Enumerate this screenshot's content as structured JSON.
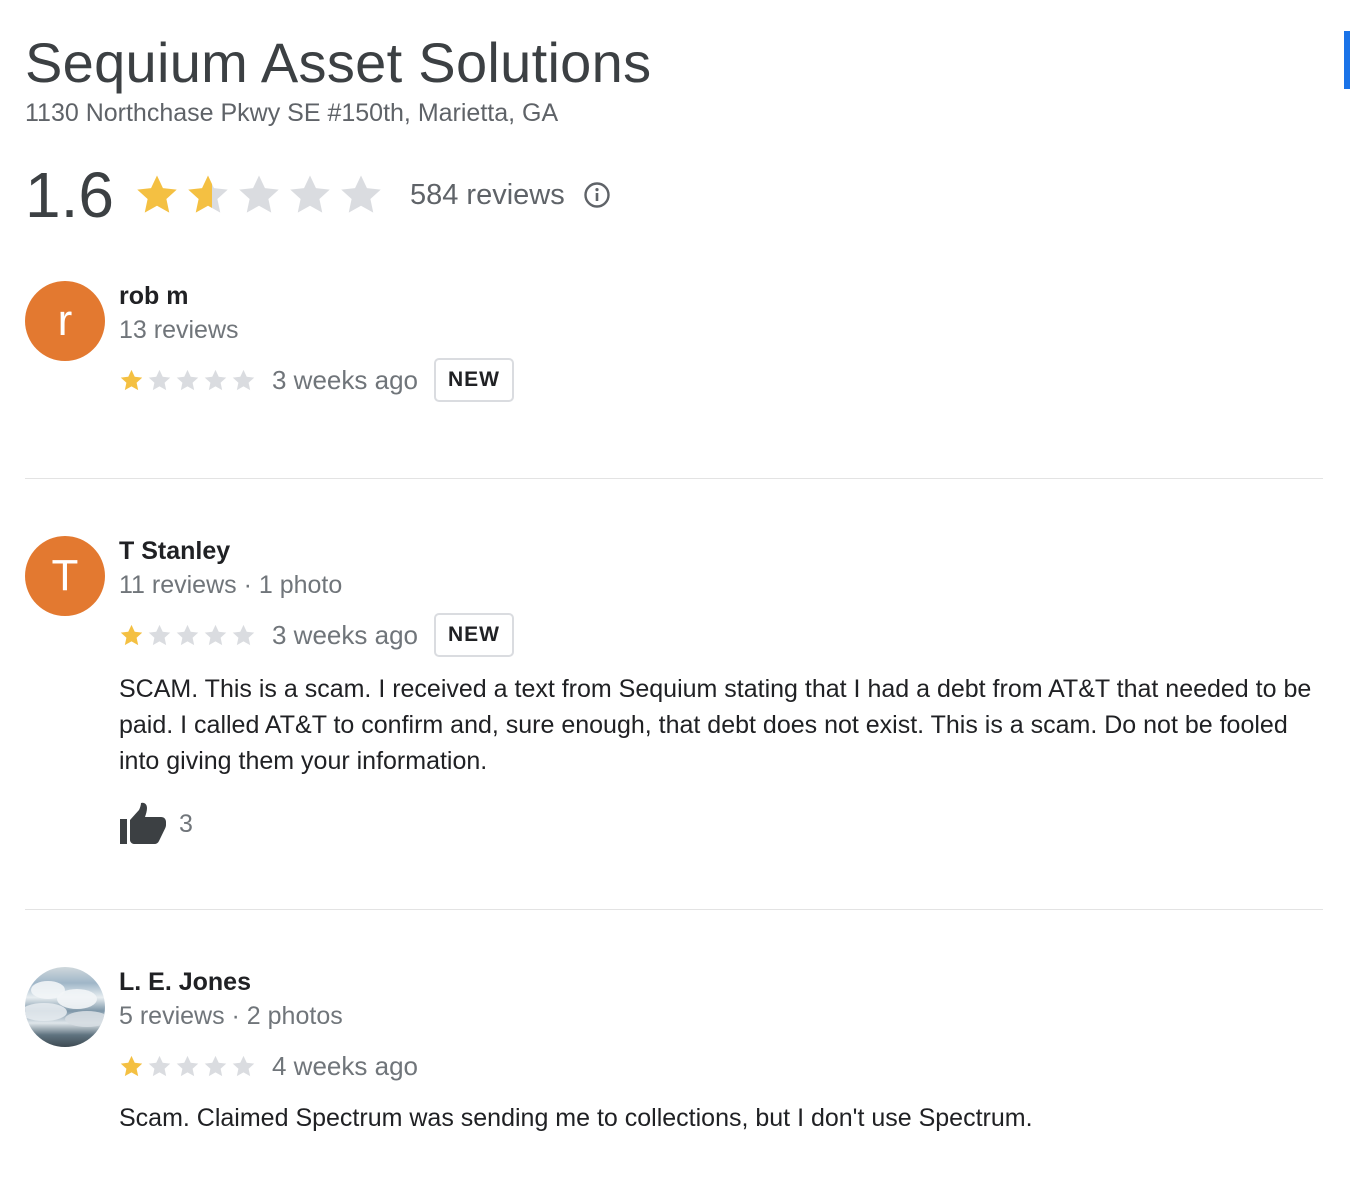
{
  "business": {
    "name": "Sequium Asset Solutions",
    "address": "1130 Northchase Pkwy SE #150th, Marietta, GA",
    "rating": "1.6",
    "rating_value": 1.6,
    "review_count": "584 reviews",
    "info_icon": "info-icon"
  },
  "colors": {
    "star_filled": "#f4c042",
    "star_empty": "#dadce0",
    "avatar_orange": "#e37930",
    "accent_blue": "#1a73e8"
  },
  "reviews": [
    {
      "avatar_letter": "r",
      "name": "rob m",
      "meta": "13 reviews",
      "stars": 1,
      "time": "3 weeks ago",
      "badge": "NEW",
      "text": "",
      "likes": ""
    },
    {
      "avatar_letter": "T",
      "name": "T Stanley",
      "meta": "11 reviews · 1 photo",
      "stars": 1,
      "time": "3 weeks ago",
      "badge": "NEW",
      "text": "SCAM. This is a scam. I received a text from Sequium stating that I had a debt from AT&T that needed to be paid. I called AT&T to confirm and, sure enough, that debt does not exist. This is a scam. Do not be fooled into giving them your information.",
      "likes": "3",
      "like_icon": "thumbs-up-icon"
    },
    {
      "avatar_letter": "",
      "name": "L. E. Jones",
      "meta": "5 reviews · 2 photos",
      "stars": 1,
      "time": "4 weeks ago",
      "badge": "",
      "text": "Scam. Claimed Spectrum was sending me to collections, but I don't use Spectrum.",
      "likes": ""
    }
  ]
}
